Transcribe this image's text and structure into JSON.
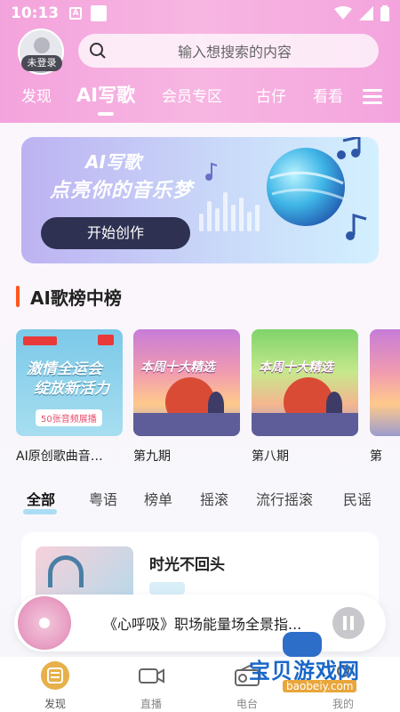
{
  "status_bar": {
    "time": "10:13",
    "notif_a": "A"
  },
  "user": {
    "login_status": "未登录"
  },
  "search": {
    "placeholder": "输入想搜索的内容"
  },
  "tabs": [
    {
      "label": "发现"
    },
    {
      "label": "AI写歌",
      "active": true
    },
    {
      "label": "会员专区"
    },
    {
      "label": "古仔"
    },
    {
      "label": "看看"
    }
  ],
  "banner": {
    "title": "AI写歌",
    "subtitle": "点亮你的音乐梦",
    "button": "开始创作"
  },
  "section": {
    "title": "AI歌榜中榜"
  },
  "albums": [
    {
      "label": "AI原创歌曲音…",
      "cover_line1": "激情全运会",
      "cover_line2": "绽放新活力",
      "cover_tag": "50张音频展播"
    },
    {
      "label": "第九期",
      "cover_title": "本周十大精选"
    },
    {
      "label": "第八期",
      "cover_title": "本周十大精选"
    },
    {
      "label": "第"
    }
  ],
  "chips": [
    {
      "label": "全部",
      "active": true
    },
    {
      "label": "粤语"
    },
    {
      "label": "榜单"
    },
    {
      "label": "摇滚"
    },
    {
      "label": "流行摇滚"
    },
    {
      "label": "民谣"
    }
  ],
  "song_card": {
    "name": "时光不回头"
  },
  "player": {
    "now_playing": "《心呼吸》职场能量场全景指..."
  },
  "bottom_nav": [
    {
      "label": "发现",
      "icon": "discover-icon",
      "active": true
    },
    {
      "label": "直播",
      "icon": "video-camera-icon"
    },
    {
      "label": "电台",
      "icon": "radio-icon"
    },
    {
      "label": "我的",
      "icon": "profile-icon"
    }
  ],
  "watermark": {
    "text": "宝贝游戏网",
    "url": "baobeiy.com"
  },
  "colors": {
    "header": "#f3a3dc",
    "accent_bar": "#ff5722",
    "banner_button": "#2f3152"
  }
}
